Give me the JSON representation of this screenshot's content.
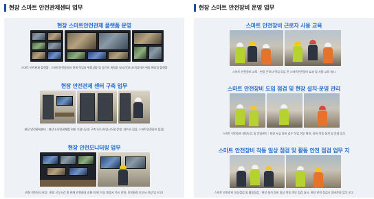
{
  "left": {
    "heading": "현장 스마트 안전관제센터 업무",
    "blocks": [
      {
        "title": "현장 스마트안전관제 플랫폼 운영",
        "caption": "스마트 안전관제 플랫폼 : 스마트안전장비와 연계 작업자 위험상황 및 공간의 위험을 실시간(모니터링)하여 위험 예방함 플랫폼"
      },
      {
        "title": "현장 안전관제 센터 구축 업무",
        "caption": "현장 안전관제센터 : 현장내 안전관제를 위한 기설시무실 구축 (모니터링시스템 운영, 네트워 점검, 스마트안전장비 점검)"
      },
      {
        "title": "현장 안전모니터링 업무",
        "caption": "현장 안전모니터링 : 현장 근무시간 중 현재 안전환경 순환 (인인 이상 발생시 즉시 전파, 안전환경 보고서 작성 및 보고)"
      }
    ]
  },
  "right": {
    "heading": "현장 스마트 안전장비 운영 업무",
    "blocks": [
      {
        "title": "스마트 안전장비 근로자 사용 교육",
        "caption": "스마트 안전장비 교육 : 현장 근로자 작업 투입 전 스마트안전장비 효과 및 사용 교육 실시"
      },
      {
        "title": "스마트 안전장비 도입 점검 및 현장 설치·운영 관리",
        "caption": "스마트 안전장비 현장도입 및 운영관리 : 현장 도입 장비 검수 작업 여부 확인, 장비 작동 설치 및 운영 업무"
      },
      {
        "title": "스마트 안전장비 작동 일상 점검 및 활동 안전 점검 업무 지",
        "caption": "스마트 안전장비 일상점검 및 활동점검 : 현장 설치 장비 일상 작동 여부 점검 실시, 현장 안전 점검시 장비운영 업무 보고"
      }
    ]
  }
}
